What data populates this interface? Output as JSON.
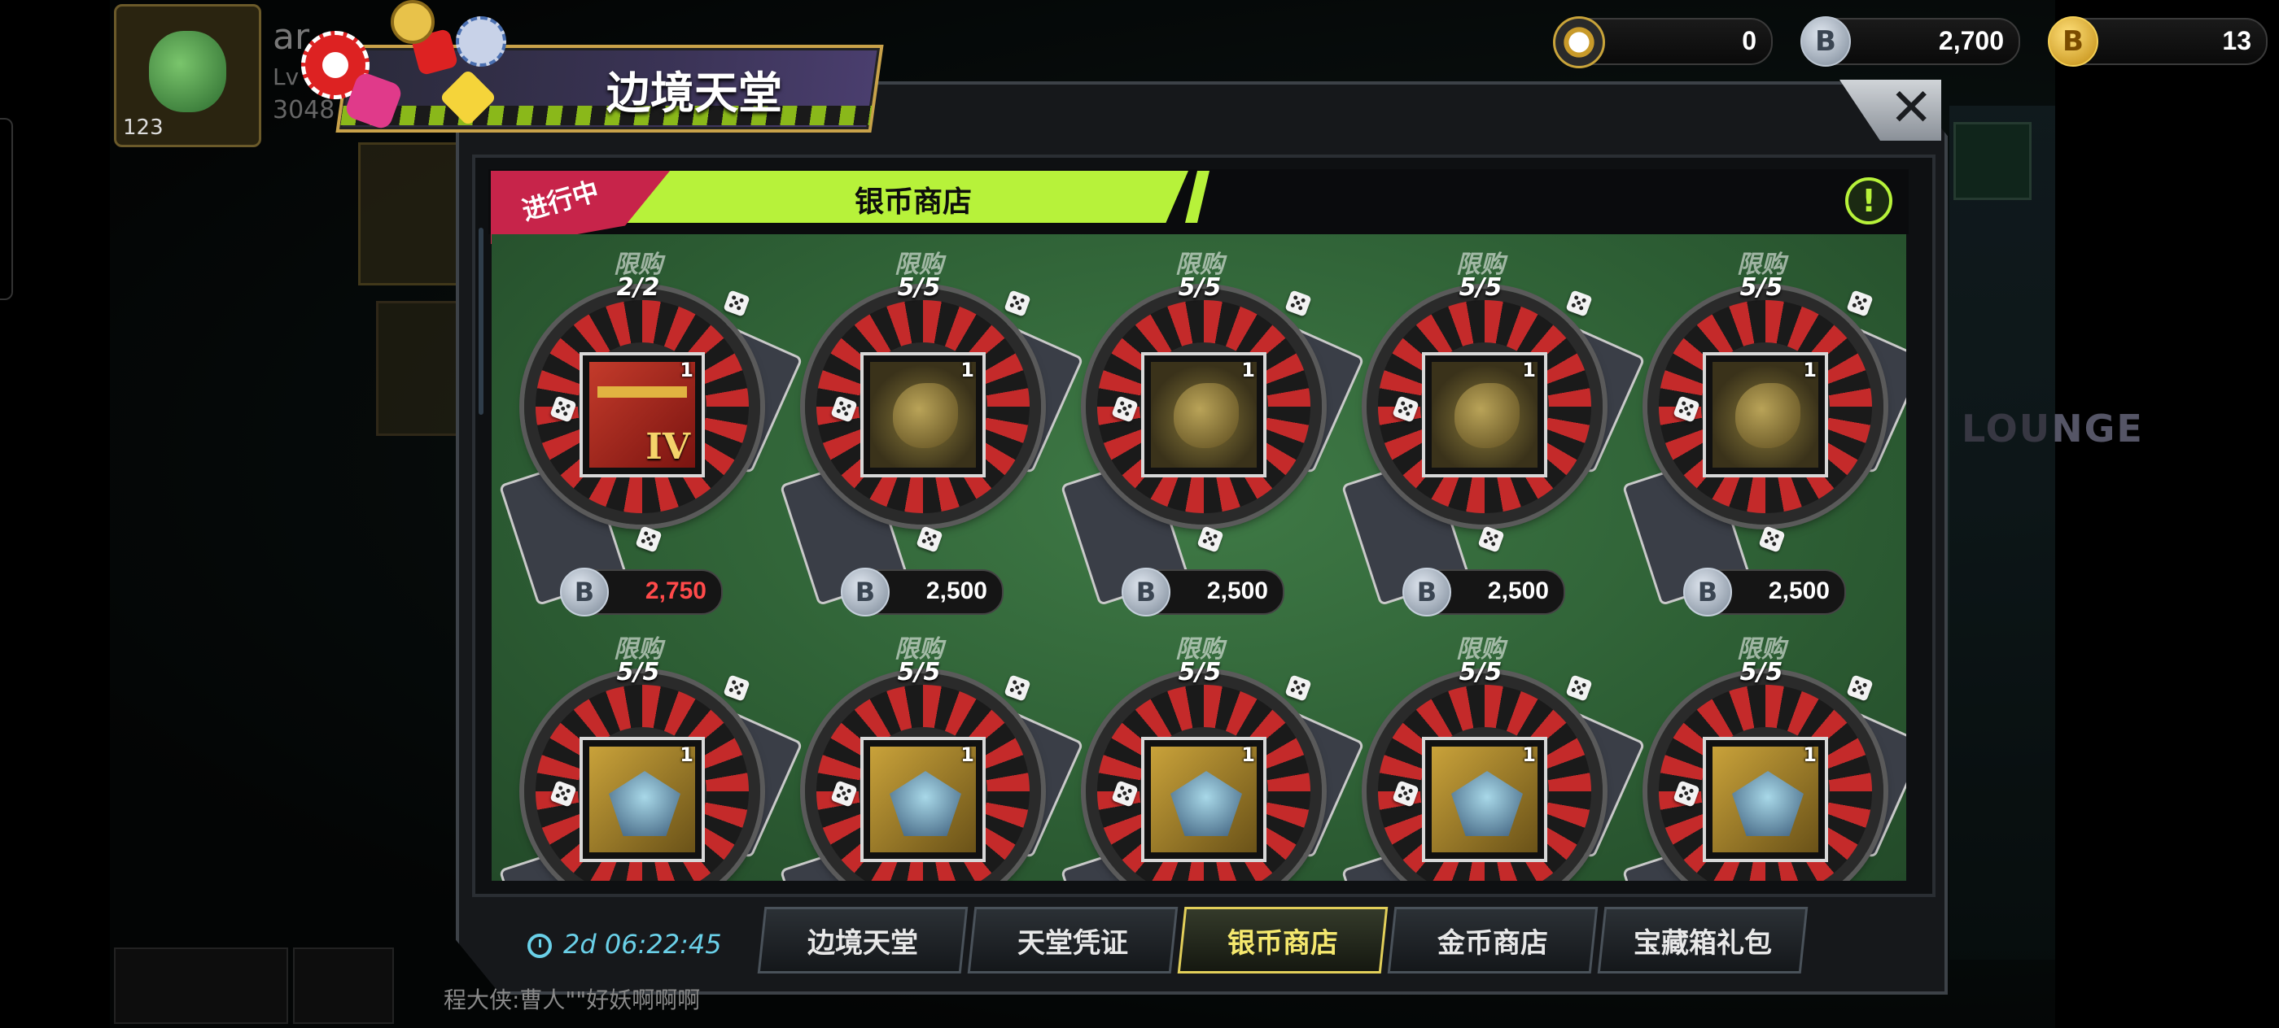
{
  "currency": [
    {
      "icon": "casino-chip-icon",
      "value": "0"
    },
    {
      "icon": "silver-coin-icon",
      "glyph": "B",
      "value": "2,700"
    },
    {
      "icon": "gold-coin-icon",
      "glyph": "B",
      "value": "13"
    }
  ],
  "player": {
    "name": "ar",
    "level_label": "Lv",
    "exp": "3048",
    "level": "123"
  },
  "event_title": "边境天堂",
  "close_label": "✕",
  "section": {
    "status": "进行中",
    "title": "银币商店",
    "info_glyph": "!"
  },
  "price_coin_glyph": "B",
  "items": [
    {
      "limit_label": "限购",
      "count": "2/2",
      "qty": "1",
      "price": "2,750",
      "price_color": "#ff4a4a",
      "art": "chest",
      "chest_tier": "IV"
    },
    {
      "limit_label": "限购",
      "count": "5/5",
      "qty": "1",
      "price": "2,500",
      "price_color": "#ffffff",
      "art": "shard-gold"
    },
    {
      "limit_label": "限购",
      "count": "5/5",
      "qty": "1",
      "price": "2,500",
      "price_color": "#ffffff",
      "art": "shard-gold"
    },
    {
      "limit_label": "限购",
      "count": "5/5",
      "qty": "1",
      "price": "2,500",
      "price_color": "#ffffff",
      "art": "shard-gold"
    },
    {
      "limit_label": "限购",
      "count": "5/5",
      "qty": "1",
      "price": "2,500",
      "price_color": "#ffffff",
      "art": "shard-gold"
    },
    {
      "limit_label": "限购",
      "count": "5/5",
      "qty": "1",
      "art": "shard-ice"
    },
    {
      "limit_label": "限购",
      "count": "5/5",
      "qty": "1",
      "art": "shard-ice"
    },
    {
      "limit_label": "限购",
      "count": "5/5",
      "qty": "1",
      "art": "shard-ice"
    },
    {
      "limit_label": "限购",
      "count": "5/5",
      "qty": "1",
      "art": "shard-ice"
    },
    {
      "limit_label": "限购",
      "count": "5/5",
      "qty": "1",
      "art": "shard-ice"
    }
  ],
  "timer": "2d 06:22:45",
  "tabs": [
    {
      "label": "边境天堂",
      "active": false
    },
    {
      "label": "天堂凭证",
      "active": false
    },
    {
      "label": "银币商店",
      "active": true
    },
    {
      "label": "金币商店",
      "active": false
    },
    {
      "label": "宝藏箱礼包",
      "active": false
    }
  ],
  "chat": {
    "text": "程大侠:曹人\"\"好妖啊啊啊"
  },
  "background_sign": "LOUNGE",
  "colors": {
    "accent_green": "#b7f23a",
    "status_red": "#c7244a",
    "timer_cyan": "#6ad0e8",
    "active_tab_gold": "#e2cf5a"
  }
}
